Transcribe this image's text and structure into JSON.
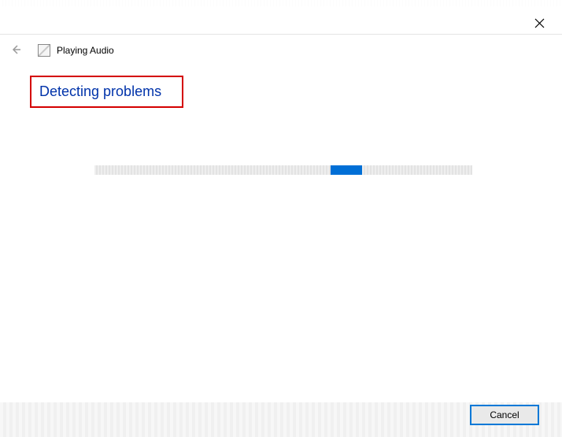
{
  "header": {
    "title": "Playing Audio",
    "app_icon": "audio-troubleshooter-icon"
  },
  "status_text": "Detecting problems",
  "progress": {
    "indeterminate": true
  },
  "buttons": {
    "cancel_label": "Cancel"
  }
}
